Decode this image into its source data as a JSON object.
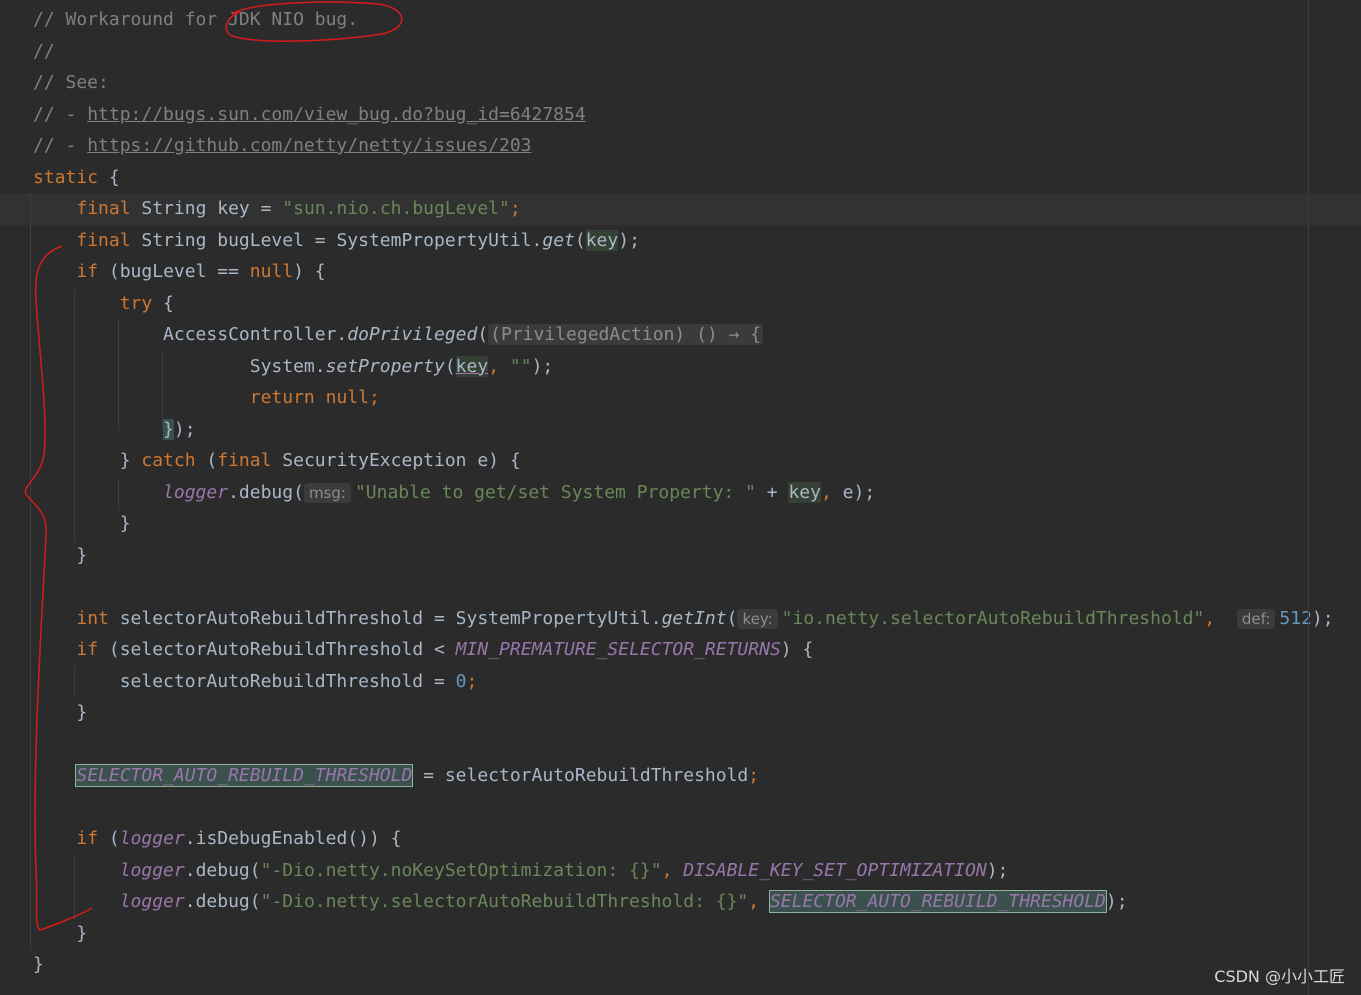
{
  "editor": {
    "colors": {
      "background": "#2b2b2b",
      "comment": "#808080",
      "keyword": "#cc7832",
      "string": "#6a8759",
      "number": "#6897bb",
      "static_field": "#9876aa",
      "annotation_red": "#d51c1c"
    },
    "lines": [
      [
        {
          "t": "// Workaround for JDK NIO bug.",
          "c": "comment"
        }
      ],
      [
        {
          "t": "//",
          "c": "comment"
        }
      ],
      [
        {
          "t": "// See:",
          "c": "comment"
        }
      ],
      [
        {
          "t": "// - ",
          "c": "comment"
        },
        {
          "t": "http://bugs.sun.com/view_bug.do?bug_id=6427854",
          "c": "link"
        }
      ],
      [
        {
          "t": "// - ",
          "c": "comment"
        },
        {
          "t": "https://github.com/netty/netty/issues/203",
          "c": "link"
        }
      ],
      [
        {
          "t": "static",
          "c": "keyword"
        },
        {
          "t": " {",
          "c": ""
        }
      ],
      [
        {
          "t": "    "
        },
        {
          "t": "final",
          "c": "keyword"
        },
        {
          "t": " String "
        },
        {
          "t": "key"
        },
        {
          "t": " = "
        },
        {
          "t": "\"sun.nio.ch.bugLevel\"",
          "c": "string"
        },
        {
          "t": ";",
          "c": "punct"
        }
      ],
      [
        {
          "t": "    "
        },
        {
          "t": "final",
          "c": "keyword"
        },
        {
          "t": " String bugLevel = SystemPropertyUtil."
        },
        {
          "t": "get",
          "c": "method-italic"
        },
        {
          "t": "("
        },
        {
          "t": "key",
          "c": "var-hl"
        },
        {
          "t": ");"
        }
      ],
      [
        {
          "t": "    "
        },
        {
          "t": "if",
          "c": "keyword"
        },
        {
          "t": " (bugLevel == "
        },
        {
          "t": "null",
          "c": "keyword"
        },
        {
          "t": ") {"
        }
      ],
      [
        {
          "t": "        "
        },
        {
          "t": "try",
          "c": "keyword"
        },
        {
          "t": " {"
        }
      ],
      [
        {
          "t": "            AccessController."
        },
        {
          "t": "doPrivileged",
          "c": "method-italic"
        },
        {
          "t": "("
        },
        {
          "t": "(PrivilegedAction) () → {",
          "c": "fold-hint"
        }
      ],
      [
        {
          "t": "                    System."
        },
        {
          "t": "setProperty",
          "c": "method-italic"
        },
        {
          "t": "("
        },
        {
          "t": "key",
          "c": "var-hl-under"
        },
        {
          "t": ", ",
          "c": "punct"
        },
        {
          "t": "\"\"",
          "c": "string"
        },
        {
          "t": ");"
        }
      ],
      [
        {
          "t": "                    "
        },
        {
          "t": "return",
          "c": "keyword"
        },
        {
          "t": " "
        },
        {
          "t": "null",
          "c": "keyword"
        },
        {
          "t": ";",
          "c": "punct"
        }
      ],
      [
        {
          "t": "            "
        },
        {
          "t": "}",
          "c": "brace-hl"
        },
        {
          "t": ");"
        }
      ],
      [
        {
          "t": "        } "
        },
        {
          "t": "catch",
          "c": "keyword"
        },
        {
          "t": " ("
        },
        {
          "t": "final",
          "c": "keyword"
        },
        {
          "t": " SecurityException e) {"
        }
      ],
      [
        {
          "t": "            "
        },
        {
          "t": "logger",
          "c": "logger"
        },
        {
          "t": ".debug("
        },
        {
          "t": "msg:",
          "c": "hint"
        },
        {
          "t": "\"Unable to get/set System Property: \"",
          "c": "string"
        },
        {
          "t": " + "
        },
        {
          "t": "key",
          "c": "var-hl"
        },
        {
          "t": ", ",
          "c": "punct"
        },
        {
          "t": "e);"
        }
      ],
      [
        {
          "t": "        }"
        }
      ],
      [
        {
          "t": "    }"
        }
      ],
      [
        {
          "t": ""
        }
      ],
      [
        {
          "t": "    "
        },
        {
          "t": "int",
          "c": "keyword"
        },
        {
          "t": " selectorAutoRebuildThreshold = SystemPropertyUtil."
        },
        {
          "t": "getInt",
          "c": "method-italic"
        },
        {
          "t": "("
        },
        {
          "t": "key:",
          "c": "hint"
        },
        {
          "t": "\"io.netty.selectorAutoRebuildThreshold\"",
          "c": "string"
        },
        {
          "t": ",  ",
          "c": "punct"
        },
        {
          "t": "def:",
          "c": "hint"
        },
        {
          "t": "512",
          "c": "number"
        },
        {
          "t": ");"
        }
      ],
      [
        {
          "t": "    "
        },
        {
          "t": "if",
          "c": "keyword"
        },
        {
          "t": " (selectorAutoRebuildThreshold < "
        },
        {
          "t": "MIN_PREMATURE_SELECTOR_RETURNS",
          "c": "static-field"
        },
        {
          "t": ") {"
        }
      ],
      [
        {
          "t": "        selectorAutoRebuildThreshold = "
        },
        {
          "t": "0",
          "c": "number"
        },
        {
          "t": ";",
          "c": "punct"
        }
      ],
      [
        {
          "t": "    }"
        }
      ],
      [
        {
          "t": ""
        }
      ],
      [
        {
          "t": "    "
        },
        {
          "t": "SELECTOR_AUTO_REBUILD_THRESHOLD",
          "c": "static-field box-hl"
        },
        {
          "t": " = selectorAutoRebuildThreshold"
        },
        {
          "t": ";",
          "c": "punct"
        }
      ],
      [
        {
          "t": ""
        }
      ],
      [
        {
          "t": "    "
        },
        {
          "t": "if",
          "c": "keyword"
        },
        {
          "t": " ("
        },
        {
          "t": "logger",
          "c": "logger"
        },
        {
          "t": ".isDebugEnabled()) {"
        }
      ],
      [
        {
          "t": "        "
        },
        {
          "t": "logger",
          "c": "logger"
        },
        {
          "t": ".debug("
        },
        {
          "t": "\"-Dio.netty.noKeySetOptimization: {}\"",
          "c": "string"
        },
        {
          "t": ", ",
          "c": "punct"
        },
        {
          "t": "DISABLE_KEY_SET_OPTIMIZATION",
          "c": "static-field"
        },
        {
          "t": ");"
        }
      ],
      [
        {
          "t": "        "
        },
        {
          "t": "logger",
          "c": "logger"
        },
        {
          "t": ".debug("
        },
        {
          "t": "\"-Dio.netty.selectorAutoRebuildThreshold: {}\"",
          "c": "string"
        },
        {
          "t": ", ",
          "c": "punct"
        },
        {
          "t": "SELECTOR_AUTO_REBUILD_THRESHOLD",
          "c": "static-field box-hl"
        },
        {
          "t": ");"
        }
      ],
      [
        {
          "t": "    }"
        }
      ],
      [
        {
          "t": "}"
        }
      ]
    ],
    "current_line_index": 6
  },
  "watermark": "CSDN @小小工匠"
}
